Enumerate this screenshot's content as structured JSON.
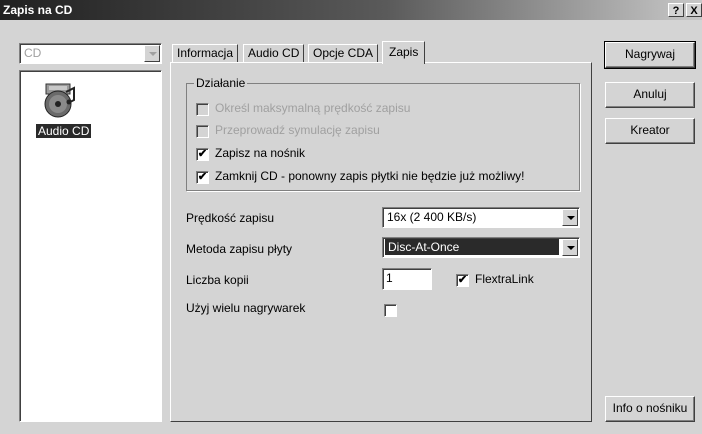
{
  "window": {
    "title": "Zapis na CD",
    "help_label": "?",
    "close_label": "X"
  },
  "left": {
    "combo_value": "CD",
    "items": [
      {
        "label": "Audio CD",
        "icon": "audio-cd-icon"
      }
    ]
  },
  "tabs": [
    {
      "label": "Informacja"
    },
    {
      "label": "Audio CD"
    },
    {
      "label": "Opcje CDA"
    },
    {
      "label": "Zapis",
      "active": true
    }
  ],
  "group": {
    "title": "Działanie",
    "options": [
      {
        "label": "Określ maksymalną prędkość zapisu",
        "checked": false,
        "enabled": false
      },
      {
        "label": "Przeprowadź symulację zapisu",
        "checked": false,
        "enabled": false
      },
      {
        "label": "Zapisz na nośnik",
        "checked": true,
        "enabled": true
      },
      {
        "label": "Zamknij CD - ponowny zapis płytki nie będzie już możliwy!",
        "checked": true,
        "enabled": true
      }
    ]
  },
  "settings": {
    "speed_label": "Prędkość zapisu",
    "speed_value": "16x (2 400 KB/s)",
    "method_label": "Metoda zapisu płyty",
    "method_value": "Disc-At-Once",
    "copies_label": "Liczba kopii",
    "copies_value": "1",
    "flextra_label": "FlextraLink",
    "flextra_checked": true,
    "multi_label": "Użyj wielu nagrywarek",
    "multi_checked": false
  },
  "buttons": {
    "burn": "Nagrywaj",
    "cancel": "Anuluj",
    "wizard": "Kreator",
    "media_info": "Info o nośniku"
  },
  "marks": {
    "checked": "✔",
    "unchecked": ""
  }
}
